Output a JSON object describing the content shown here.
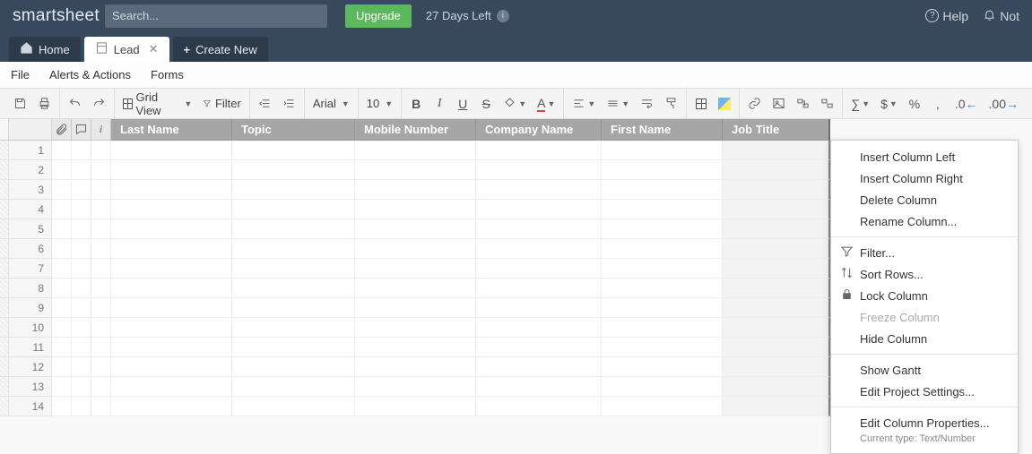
{
  "topbar": {
    "logo": "smartsheet",
    "search_placeholder": "Search...",
    "upgrade": "Upgrade",
    "days_left": "27 Days Left",
    "help": "Help",
    "notify": "Not"
  },
  "tabs": {
    "home": "Home",
    "active": "Lead",
    "create": "Create New"
  },
  "menus": [
    "File",
    "Alerts & Actions",
    "Forms"
  ],
  "toolbar": {
    "view": "Grid View",
    "filter": "Filter",
    "font": "Arial",
    "size": "10",
    "currency": "$",
    "percent": "%",
    "thousand": ",",
    "dec_less": ".0",
    "dec_more": ".00"
  },
  "columns": [
    "Last Name",
    "Topic",
    "Mobile Number",
    "Company Name",
    "First Name",
    "Job Title"
  ],
  "row_count": 14,
  "context_menu": {
    "insert_left": "Insert Column Left",
    "insert_right": "Insert Column Right",
    "delete": "Delete Column",
    "rename": "Rename Column...",
    "filter": "Filter...",
    "sort": "Sort Rows...",
    "lock": "Lock Column",
    "freeze": "Freeze Column",
    "hide": "Hide Column",
    "gantt": "Show Gantt",
    "proj": "Edit Project Settings...",
    "props": "Edit Column Properties...",
    "subtype": "Current type: Text/Number"
  }
}
